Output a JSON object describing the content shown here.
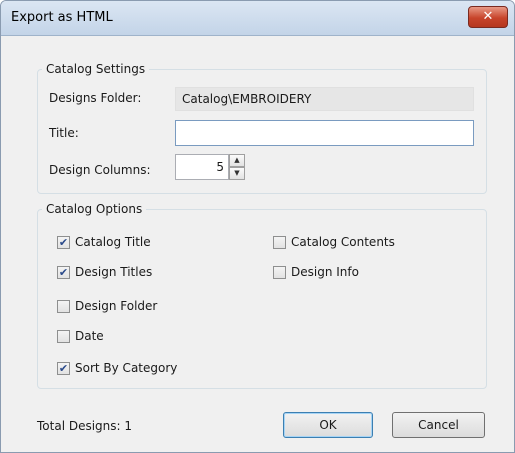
{
  "window": {
    "title": "Export as HTML",
    "close_glyph": "✕"
  },
  "catalog_settings": {
    "legend": "Catalog Settings",
    "designs_folder_label": "Designs Folder:",
    "designs_folder_value": "Catalog\\EMBROIDERY",
    "title_label": "Title:",
    "title_value": "",
    "design_columns_label": "Design Columns:",
    "design_columns_value": "5"
  },
  "catalog_options": {
    "legend": "Catalog Options",
    "items": [
      {
        "label": "Catalog Title",
        "checked": true
      },
      {
        "label": "Design Titles",
        "checked": true
      },
      {
        "label": "Design Folder",
        "checked": false
      },
      {
        "label": "Date",
        "checked": false
      },
      {
        "label": "Sort By Category",
        "checked": true
      },
      {
        "label": "Catalog Contents",
        "checked": false
      },
      {
        "label": "Design Info",
        "checked": false
      }
    ]
  },
  "footer": {
    "total_designs": "Total Designs: 1",
    "ok_label": "OK",
    "cancel_label": "Cancel"
  }
}
